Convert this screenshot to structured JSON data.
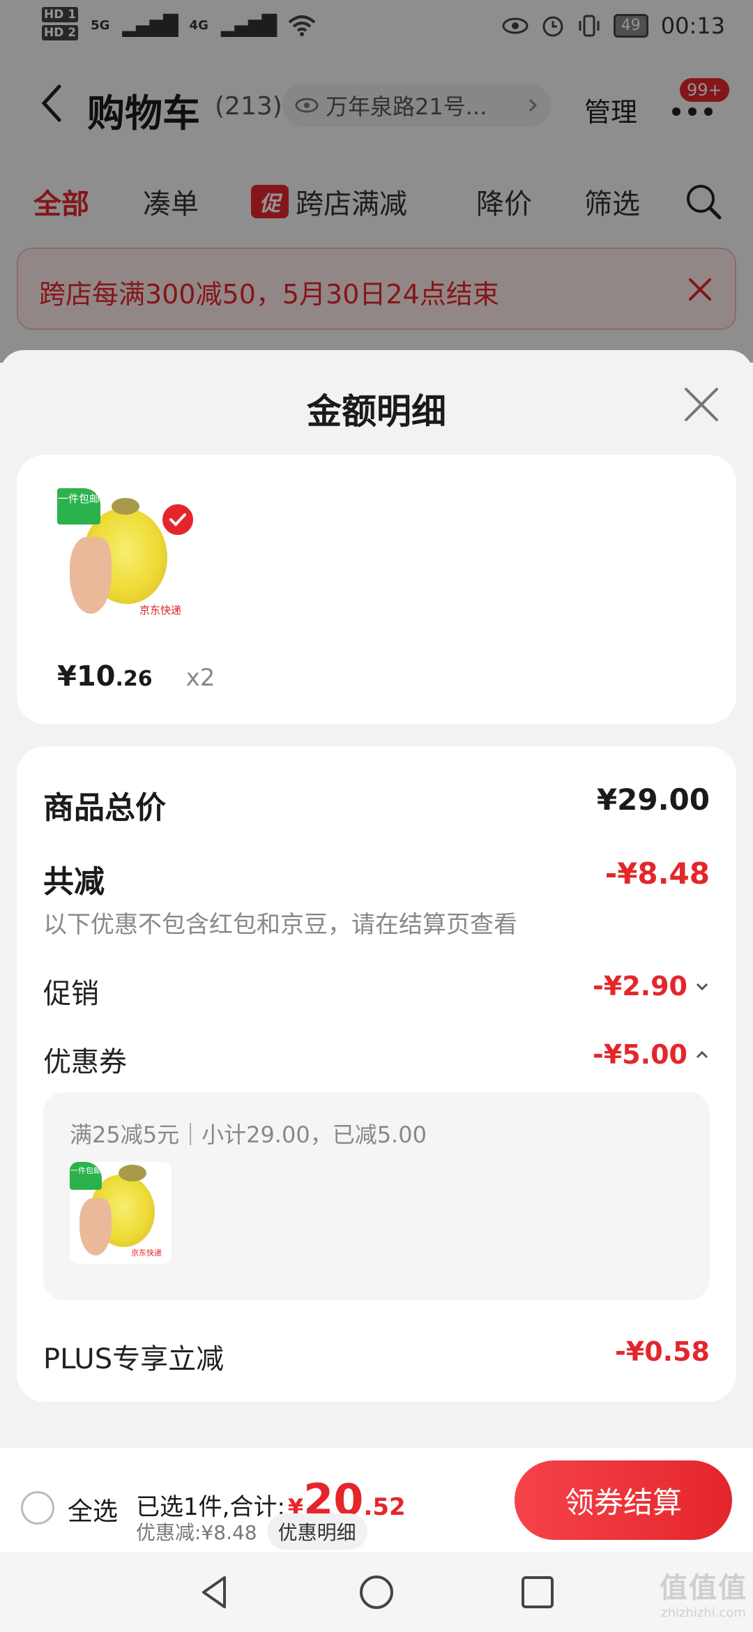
{
  "status_bar": {
    "hd1": "HD 1",
    "hd2": "HD 2",
    "net1": "5G",
    "net2": "4G",
    "battery": "49",
    "time": "00:13"
  },
  "header": {
    "title": "购物车",
    "count": "(213)",
    "address": "万年泉路21号...",
    "manage": "管理",
    "badge": "99+"
  },
  "tabs": [
    {
      "label": "全部"
    },
    {
      "label": "凑单"
    },
    {
      "label": "跨店满减",
      "tag": "促"
    },
    {
      "label": "降价"
    },
    {
      "label": "筛选"
    }
  ],
  "notice": {
    "text": "跨店每满300减50，5月30日24点结束"
  },
  "sheet": {
    "title": "金额明细",
    "product": {
      "free_ship": "一件包邮",
      "brand_mark": "京东快递",
      "price_yen": "¥",
      "price_int": "10",
      "price_dec": ".26",
      "qty": "x2"
    },
    "rows": {
      "total_label": "商品总价",
      "total_value": "¥29.00",
      "reduce_label": "共减",
      "reduce_value": "-¥8.48",
      "reduce_note": "以下优惠不包含红包和京豆，请在结算页查看",
      "promo_label": "促销",
      "promo_value": "-¥2.90",
      "coupon_label": "优惠券",
      "coupon_value": "-¥5.00",
      "coupon_detail": "满25减5元｜小计29.00，已减5.00",
      "plus_label": "PLUS专享立减",
      "plus_value": "-¥0.58"
    }
  },
  "bottom_bar": {
    "select_all": "全选",
    "selected_text": "已选1件,合计:",
    "yen": "¥",
    "total_int": "20",
    "total_dec": ".52",
    "discount_text": "优惠减:¥8.48",
    "detail_btn": "优惠明细",
    "checkout": "领券结算"
  },
  "watermark": {
    "top": "值值值",
    "bottom": "zhizhizhi.com"
  },
  "colors": {
    "accent": "#e4262b",
    "free_ship": "#2bb24c"
  }
}
